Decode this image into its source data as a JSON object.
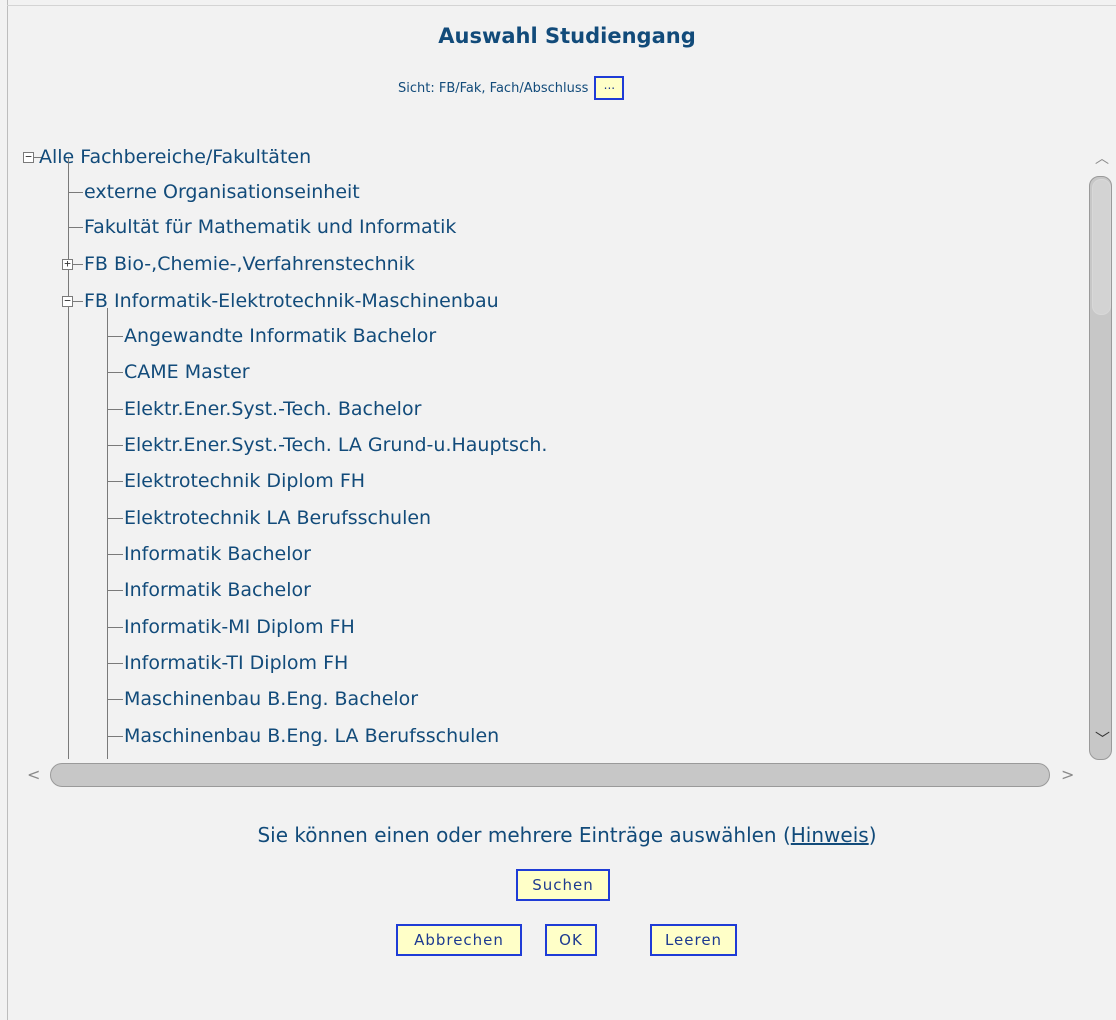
{
  "dialog": {
    "title": "Auswahl Studiengang",
    "view_label": "Sicht: FB/Fak, Fach/Abschluss",
    "view_button_label": "..."
  },
  "tree": {
    "root": {
      "label": "Alle Fachbereiche/Fakultäten",
      "expanded": true
    },
    "level1": [
      {
        "label": "externe Organisationseinheit",
        "expandable": false
      },
      {
        "label": "Fakultät für Mathematik und Informatik",
        "expandable": false
      },
      {
        "label": "FB Bio-,Chemie-,Verfahrenstechnik",
        "expandable": true,
        "expanded": false
      },
      {
        "label": "FB Informatik-Elektrotechnik-Maschinenbau",
        "expandable": true,
        "expanded": true
      }
    ],
    "level2": [
      {
        "label": "Angewandte Informatik Bachelor"
      },
      {
        "label": "CAME Master"
      },
      {
        "label": "Elektr.Ener.Syst.-Tech. Bachelor"
      },
      {
        "label": "Elektr.Ener.Syst.-Tech. LA Grund-u.Hauptsch."
      },
      {
        "label": "Elektrotechnik Diplom FH"
      },
      {
        "label": "Elektrotechnik LA Berufsschulen"
      },
      {
        "label": "Informatik Bachelor"
      },
      {
        "label": "Informatik Bachelor"
      },
      {
        "label": "Informatik-MI Diplom FH"
      },
      {
        "label": "Informatik-TI Diplom FH"
      },
      {
        "label": "Maschinenbau B.Eng. Bachelor"
      },
      {
        "label": "Maschinenbau B.Eng. LA Berufsschulen"
      }
    ]
  },
  "footer": {
    "hint_text": "Sie können einen oder mehrere Einträge auswählen (",
    "hint_link": "Hinweis",
    "hint_close": ")",
    "search_label": "Suchen",
    "cancel_label": "Abbrechen",
    "ok_label": "OK",
    "clear_label": "Leeren"
  },
  "icons": {
    "collapse": "−",
    "expand": "+",
    "scroll_up": "chevron-up-icon",
    "scroll_down": "chevron-down-icon",
    "scroll_left": "chevron-left-icon",
    "scroll_right": "chevron-right-icon"
  },
  "colors": {
    "text": "#124b7a",
    "button_bg": "#ffffc8",
    "button_border": "#1f3cd6",
    "background": "#f2f2f2"
  }
}
